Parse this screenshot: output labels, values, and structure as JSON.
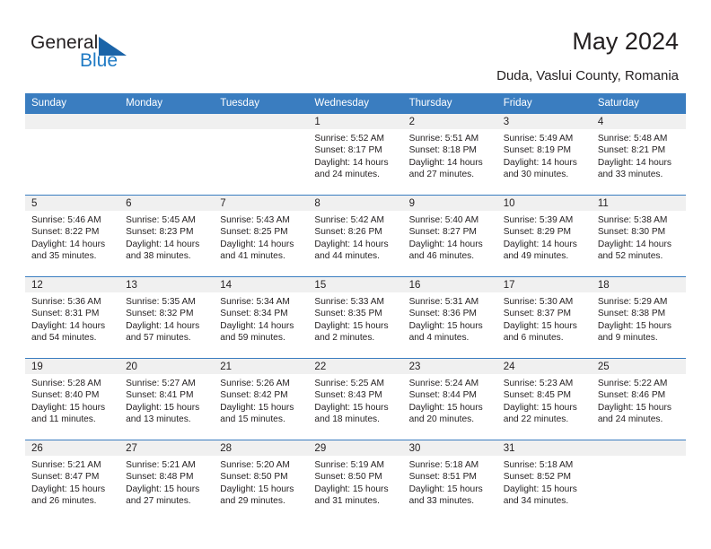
{
  "brand": {
    "word_one": "General",
    "word_two": "Blue",
    "triangle_color": "#1b64a8",
    "blue_text_color": "#1f7ac4"
  },
  "header": {
    "title": "May 2024",
    "subtitle": "Duda, Vaslui County, Romania"
  },
  "theme": {
    "header_row_bg": "#3a7dc0",
    "header_row_text": "#ffffff",
    "daynum_band_bg": "#f0f0f0",
    "cell_bg": "#ffffff",
    "rule_color": "#3a7dc0",
    "body_text": "#231f20"
  },
  "weekday_headers": [
    "Sunday",
    "Monday",
    "Tuesday",
    "Wednesday",
    "Thursday",
    "Friday",
    "Saturday"
  ],
  "labels": {
    "sunrise_prefix": "Sunrise:",
    "sunset_prefix": "Sunset:",
    "daylight_prefix": "Daylight:"
  },
  "weeks": [
    [
      {
        "day": "",
        "empty": true
      },
      {
        "day": "",
        "empty": true
      },
      {
        "day": "",
        "empty": true
      },
      {
        "day": "1",
        "sunrise": "Sunrise: 5:52 AM",
        "sunset": "Sunset: 8:17 PM",
        "daylight": "Daylight: 14 hours and 24 minutes."
      },
      {
        "day": "2",
        "sunrise": "Sunrise: 5:51 AM",
        "sunset": "Sunset: 8:18 PM",
        "daylight": "Daylight: 14 hours and 27 minutes."
      },
      {
        "day": "3",
        "sunrise": "Sunrise: 5:49 AM",
        "sunset": "Sunset: 8:19 PM",
        "daylight": "Daylight: 14 hours and 30 minutes."
      },
      {
        "day": "4",
        "sunrise": "Sunrise: 5:48 AM",
        "sunset": "Sunset: 8:21 PM",
        "daylight": "Daylight: 14 hours and 33 minutes."
      }
    ],
    [
      {
        "day": "5",
        "sunrise": "Sunrise: 5:46 AM",
        "sunset": "Sunset: 8:22 PM",
        "daylight": "Daylight: 14 hours and 35 minutes."
      },
      {
        "day": "6",
        "sunrise": "Sunrise: 5:45 AM",
        "sunset": "Sunset: 8:23 PM",
        "daylight": "Daylight: 14 hours and 38 minutes."
      },
      {
        "day": "7",
        "sunrise": "Sunrise: 5:43 AM",
        "sunset": "Sunset: 8:25 PM",
        "daylight": "Daylight: 14 hours and 41 minutes."
      },
      {
        "day": "8",
        "sunrise": "Sunrise: 5:42 AM",
        "sunset": "Sunset: 8:26 PM",
        "daylight": "Daylight: 14 hours and 44 minutes."
      },
      {
        "day": "9",
        "sunrise": "Sunrise: 5:40 AM",
        "sunset": "Sunset: 8:27 PM",
        "daylight": "Daylight: 14 hours and 46 minutes."
      },
      {
        "day": "10",
        "sunrise": "Sunrise: 5:39 AM",
        "sunset": "Sunset: 8:29 PM",
        "daylight": "Daylight: 14 hours and 49 minutes."
      },
      {
        "day": "11",
        "sunrise": "Sunrise: 5:38 AM",
        "sunset": "Sunset: 8:30 PM",
        "daylight": "Daylight: 14 hours and 52 minutes."
      }
    ],
    [
      {
        "day": "12",
        "sunrise": "Sunrise: 5:36 AM",
        "sunset": "Sunset: 8:31 PM",
        "daylight": "Daylight: 14 hours and 54 minutes."
      },
      {
        "day": "13",
        "sunrise": "Sunrise: 5:35 AM",
        "sunset": "Sunset: 8:32 PM",
        "daylight": "Daylight: 14 hours and 57 minutes."
      },
      {
        "day": "14",
        "sunrise": "Sunrise: 5:34 AM",
        "sunset": "Sunset: 8:34 PM",
        "daylight": "Daylight: 14 hours and 59 minutes."
      },
      {
        "day": "15",
        "sunrise": "Sunrise: 5:33 AM",
        "sunset": "Sunset: 8:35 PM",
        "daylight": "Daylight: 15 hours and 2 minutes."
      },
      {
        "day": "16",
        "sunrise": "Sunrise: 5:31 AM",
        "sunset": "Sunset: 8:36 PM",
        "daylight": "Daylight: 15 hours and 4 minutes."
      },
      {
        "day": "17",
        "sunrise": "Sunrise: 5:30 AM",
        "sunset": "Sunset: 8:37 PM",
        "daylight": "Daylight: 15 hours and 6 minutes."
      },
      {
        "day": "18",
        "sunrise": "Sunrise: 5:29 AM",
        "sunset": "Sunset: 8:38 PM",
        "daylight": "Daylight: 15 hours and 9 minutes."
      }
    ],
    [
      {
        "day": "19",
        "sunrise": "Sunrise: 5:28 AM",
        "sunset": "Sunset: 8:40 PM",
        "daylight": "Daylight: 15 hours and 11 minutes."
      },
      {
        "day": "20",
        "sunrise": "Sunrise: 5:27 AM",
        "sunset": "Sunset: 8:41 PM",
        "daylight": "Daylight: 15 hours and 13 minutes."
      },
      {
        "day": "21",
        "sunrise": "Sunrise: 5:26 AM",
        "sunset": "Sunset: 8:42 PM",
        "daylight": "Daylight: 15 hours and 15 minutes."
      },
      {
        "day": "22",
        "sunrise": "Sunrise: 5:25 AM",
        "sunset": "Sunset: 8:43 PM",
        "daylight": "Daylight: 15 hours and 18 minutes."
      },
      {
        "day": "23",
        "sunrise": "Sunrise: 5:24 AM",
        "sunset": "Sunset: 8:44 PM",
        "daylight": "Daylight: 15 hours and 20 minutes."
      },
      {
        "day": "24",
        "sunrise": "Sunrise: 5:23 AM",
        "sunset": "Sunset: 8:45 PM",
        "daylight": "Daylight: 15 hours and 22 minutes."
      },
      {
        "day": "25",
        "sunrise": "Sunrise: 5:22 AM",
        "sunset": "Sunset: 8:46 PM",
        "daylight": "Daylight: 15 hours and 24 minutes."
      }
    ],
    [
      {
        "day": "26",
        "sunrise": "Sunrise: 5:21 AM",
        "sunset": "Sunset: 8:47 PM",
        "daylight": "Daylight: 15 hours and 26 minutes."
      },
      {
        "day": "27",
        "sunrise": "Sunrise: 5:21 AM",
        "sunset": "Sunset: 8:48 PM",
        "daylight": "Daylight: 15 hours and 27 minutes."
      },
      {
        "day": "28",
        "sunrise": "Sunrise: 5:20 AM",
        "sunset": "Sunset: 8:50 PM",
        "daylight": "Daylight: 15 hours and 29 minutes."
      },
      {
        "day": "29",
        "sunrise": "Sunrise: 5:19 AM",
        "sunset": "Sunset: 8:50 PM",
        "daylight": "Daylight: 15 hours and 31 minutes."
      },
      {
        "day": "30",
        "sunrise": "Sunrise: 5:18 AM",
        "sunset": "Sunset: 8:51 PM",
        "daylight": "Daylight: 15 hours and 33 minutes."
      },
      {
        "day": "31",
        "sunrise": "Sunrise: 5:18 AM",
        "sunset": "Sunset: 8:52 PM",
        "daylight": "Daylight: 15 hours and 34 minutes."
      },
      {
        "day": "",
        "empty": true
      }
    ]
  ]
}
